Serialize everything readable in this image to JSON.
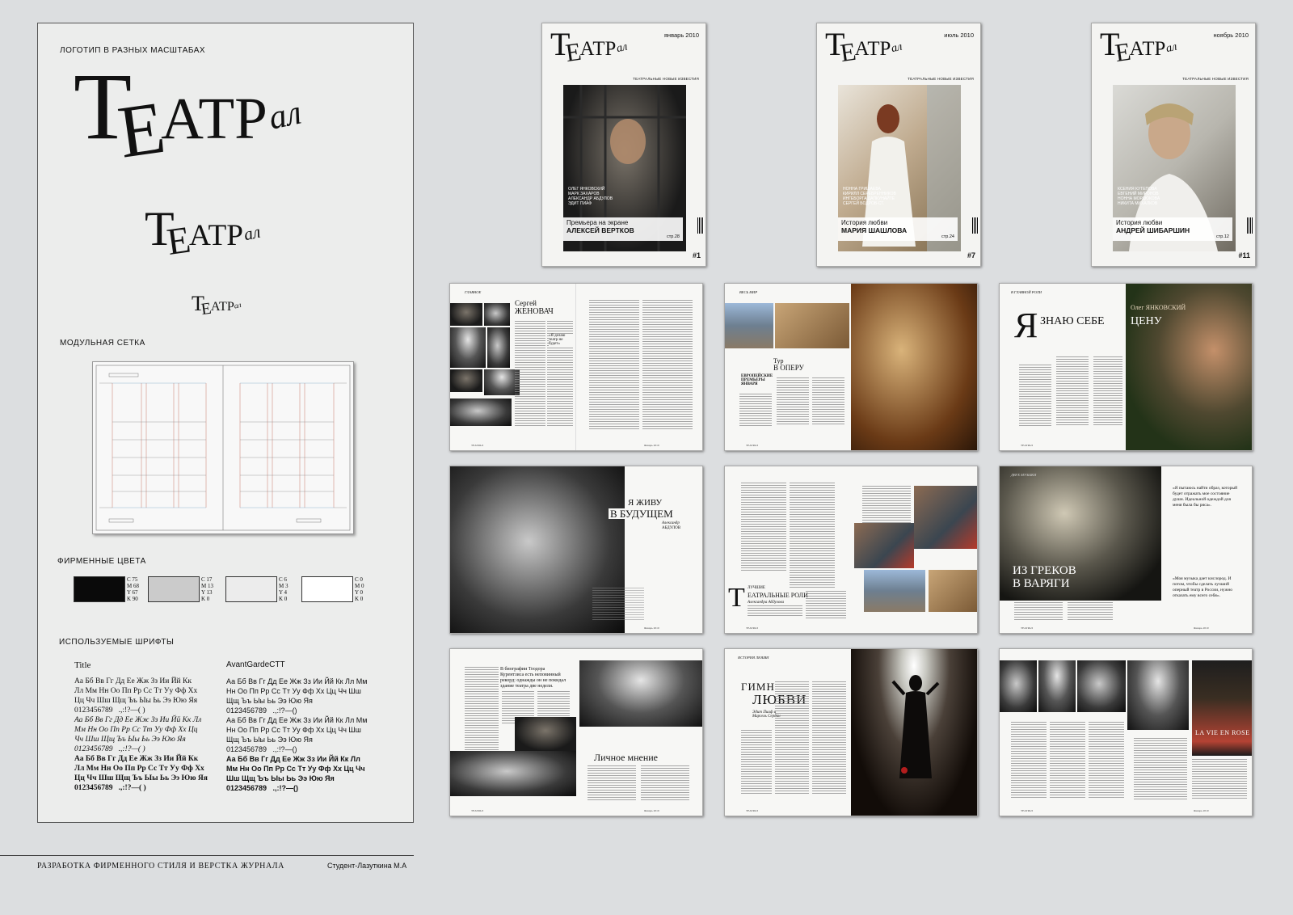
{
  "brand": {
    "logo_section": "ЛОГОТИП В РАЗНЫХ МАСШТАБАХ",
    "logo": {
      "T": "Т",
      "E": "Е",
      "rest": "АТР",
      "al": "ал"
    },
    "grid_section": "МОДУЛЬНАЯ СЕТКА",
    "colors_section": "ФИРМЕННЫЕ ЦВЕТА",
    "swatches": [
      {
        "hex": "#0a0a0a",
        "cmyk": [
          "C 75",
          "M 68",
          "Y 67",
          "K 90"
        ]
      },
      {
        "hex": "#cbcbcb",
        "cmyk": [
          "C 17",
          "M 13",
          "Y 13",
          "K 0"
        ]
      },
      {
        "hex": "#ececec",
        "cmyk": [
          "C 6",
          "M 3",
          "Y 4",
          "K 0"
        ]
      },
      {
        "hex": "#ffffff",
        "cmyk": [
          "C 0",
          "M 0",
          "Y 0",
          "K 0"
        ]
      }
    ],
    "fonts_section": "ИСПОЛЬЗУЕМЫЕ ШРИФТЫ",
    "font1": {
      "name": "Title",
      "regular": "Аа Бб Вв Гг Дд Ее Жж Зз Ии Йй Кк\nЛл Мм Нн Оо Пп Рр Сс Тт Уу Фф Хх\nЦц Чч Шш Щщ Ъъ Ыы Ьь Ээ Юю Яя\n0123456789   .,:!?—( )",
      "italic": "Аа Бб Вв Гг Дд Ее Жж Зз Ии Йй Кк Лл\nМм Нн Оо Пп Рр Сс Тт Уу Фф Хх Цц\nЧч Шш Щщ Ъъ Ыы Ьь Ээ Юю Яя\n0123456789   .,:!?—( )",
      "bold": "Аа Бб Вв Гг Дд Ее Жж Зз Ии Йй Кк\nЛл Мм Нн Оо Пп Рр Сс Тт Уу Фф Хх\nЦц Чч Шш Щщ Ъъ Ыы Ьь Ээ Юю Яя\n0123456789   .,:!?—( )"
    },
    "font2": {
      "name": "AvantGardeCTT",
      "regular": "Аа Бб Вв Гг Дд Ее Жж Зз Ии Йй Кк Лл Мм\nНн Оо Пп Рр Сс Тт Уу Фф Хх Цц Чч Шш\nЩщ Ъъ Ыы Ьь Ээ Юю Яя\n0123456789   .,:!?—()",
      "italic": "Аа Бб Вв Гг Дд Ее Жж Зз Ии Йй Кк Лл Мм\nНн Оо Пп Рр Сс Тт Уу Фф Хх Цц Чч Шш\nЩщ Ъъ Ыы Ьь Ээ Юю Яя\n0123456789   .,:!?—()",
      "bold": "Аа Бб Вв Гг Дд Ее Жж Зз Ии Йй Кк Лл\nМм Нн Оо Пп Рр Сс Тт Уу Фф Хх Цц Чч\nШш Щщ Ъъ Ыы Ьь Ээ Юю Яя\n0123456789   .,:!?—()"
    }
  },
  "footer": {
    "title": "РАЗРАБОТКА ФИРМЕННОГО СТИЛЯ И ВЕРСТКА ЖУРНАЛА",
    "author": "Студент-Лазуткина М.А"
  },
  "covers": [
    {
      "date": "январь 2010",
      "tagline": "ТЕАТРАЛЬНЫЕ НОВЫЕ ИЗВЕСТИЯ",
      "names": [
        "ОЛЕГ ЯНКОВСКИЙ",
        "МАРК ЗАХАРОВ",
        "АЛЕКСАНДР АБДУЛОВ",
        "ЭДИТ ПИАФ"
      ],
      "caption1": "Премьера на экране",
      "caption2": "АЛЕКСЕЙ ВЕРТКОВ",
      "page": "стр.28",
      "issue": "#1"
    },
    {
      "date": "июль 2010",
      "tagline": "ТЕАТРАЛЬНЫЕ НОВЫЕ ИЗВЕСТИЯ",
      "names": [
        "НОННА ГРИШАЕВА",
        "КИРИЛЛ СЕРЕБРЕННИКОВ",
        "ИНГЕБОРГА ДАПКУНАЙТЕ",
        "СЕРГЕЙ БОДРОВ-СТ."
      ],
      "caption1": "История любви",
      "caption2": "МАРИЯ ШАШЛОВА",
      "page": "стр.24",
      "issue": "#7"
    },
    {
      "date": "ноябрь 2010",
      "tagline": "ТЕАТРАЛЬНЫЕ НОВЫЕ ИЗВЕСТИЯ",
      "names": [
        "КСЕНИЯ КУТЕПОВА",
        "ЕВГЕНИЙ МИРОНОВ",
        "НОННА МОРДЮКОВА",
        "НИКИТА МИХАЛКОВ"
      ],
      "caption1": "История любви",
      "caption2": "АНДРЕЙ ШИБАРШИН",
      "page": "стр.12",
      "issue": "#11"
    }
  ],
  "spreads": {
    "s1": {
      "section": "ГЛАВНОЕ",
      "name1": "Сергей",
      "name2": "ЖЕНОВАЧ",
      "quote": "«Я делаю театр не будет»"
    },
    "s2": {
      "section": "ВЕСЬ МИР",
      "title1": "Тур",
      "title2": "В ОПЕРУ",
      "sub": "ЕВРОПЕЙСКИЕ ПРЕМЬЕРЫ ЯНВАРЯ"
    },
    "s3": {
      "section": "В ГЛАВНОЙ РОЛИ",
      "big": "Я",
      "head": "ЗНАЮ СЕБЕ",
      "name": "Олег ЯНКОВСКИЙ",
      "head2": "ЦЕНУ"
    },
    "s4": {
      "line1": "Я ЖИВУ",
      "line2": "В БУДУЩЕМ",
      "name1": "Александр",
      "name2": "АБДУЛОВ"
    },
    "s5": {
      "big": "Т",
      "head": "ЕАТРАЛЬНЫЕ РОЛИ",
      "sub": "ЛУЧШИЕ",
      "author": "Александра Абдулова"
    },
    "s6": {
      "section": "ДВУХ МУЗЫКИ",
      "line1": "ИЗ ГРЕКОВ",
      "line2": "В ВАРЯГИ",
      "quote1": "«Я пытаюсь найти образ, который будет отражать мое состояние души. Идеальной одеждой для меня была бы ряса».",
      "quote2": "«Моя музыка дает кислород. И потом, чтобы сделать лучший оперный театр в России, нужно отказать ему всего себя»."
    },
    "s7": {
      "quote": "В биографии Теодора Курентзиса есть неповинный рекорд: однажды он не покидал здание театра две недели.",
      "head": "Личное мнение"
    },
    "s8": {
      "section": "ИСТОРИЯ ЛЮБВИ",
      "line1": "ГИМН",
      "line2": "ЛЮБВИ",
      "author": "Эдит Пиаф и Марсель Сердан"
    },
    "s9": {
      "poster": "LA VIE EN ROSE"
    },
    "folio_name": "ТЕАТРАЛ",
    "folio_date": "Январь 2010"
  }
}
